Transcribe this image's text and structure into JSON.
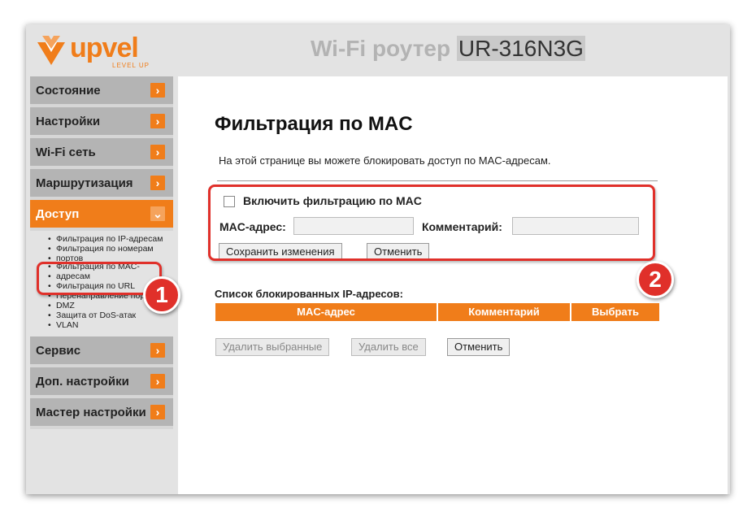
{
  "header": {
    "logo_text": "upvel",
    "logo_tagline": "LEVEL UP",
    "title": "Wi-Fi роутер",
    "model": "UR-316N3G"
  },
  "sidebar": {
    "items": [
      {
        "label": "Состояние"
      },
      {
        "label": "Настройки"
      },
      {
        "label": "Wi-Fi сеть"
      },
      {
        "label": "Маршрутизация"
      },
      {
        "label": "Доступ"
      },
      {
        "label": "Сервис"
      },
      {
        "label": "Доп. настройки"
      },
      {
        "label": "Мастер настройки"
      }
    ],
    "submenu": [
      "Фильтрация по IP-адресам",
      "Фильтрация по номерам",
      "портов",
      "Фильтрация по MAC-",
      "адресам",
      "Фильтрация по URL",
      "Перенаправление пор",
      "DMZ",
      "Защита от DoS-атак",
      "VLAN"
    ]
  },
  "main": {
    "title": "Фильтрация по MAC",
    "description": "На этой странице вы можете блокировать доступ по MAC-адресам.",
    "enable_label": "Включить фильтрацию по MAC",
    "mac_label": "MAC-адрес:",
    "mac_value": "",
    "comment_label": "Комментарий:",
    "comment_value": "",
    "save_button": "Сохранить изменения",
    "cancel_button": "Отменить",
    "list_title": "Список блокированных IP-адресов:",
    "table_headers": [
      "MAC-адрес",
      "Комментарий",
      "Выбрать"
    ],
    "delete_selected_button": "Удалить выбранные",
    "delete_all_button": "Удалить все",
    "cancel_button_2": "Отменить"
  },
  "annotations": {
    "badge1": "1",
    "badge2": "2"
  },
  "colors": {
    "accent": "#f07d1a",
    "highlight": "#e0302a"
  }
}
